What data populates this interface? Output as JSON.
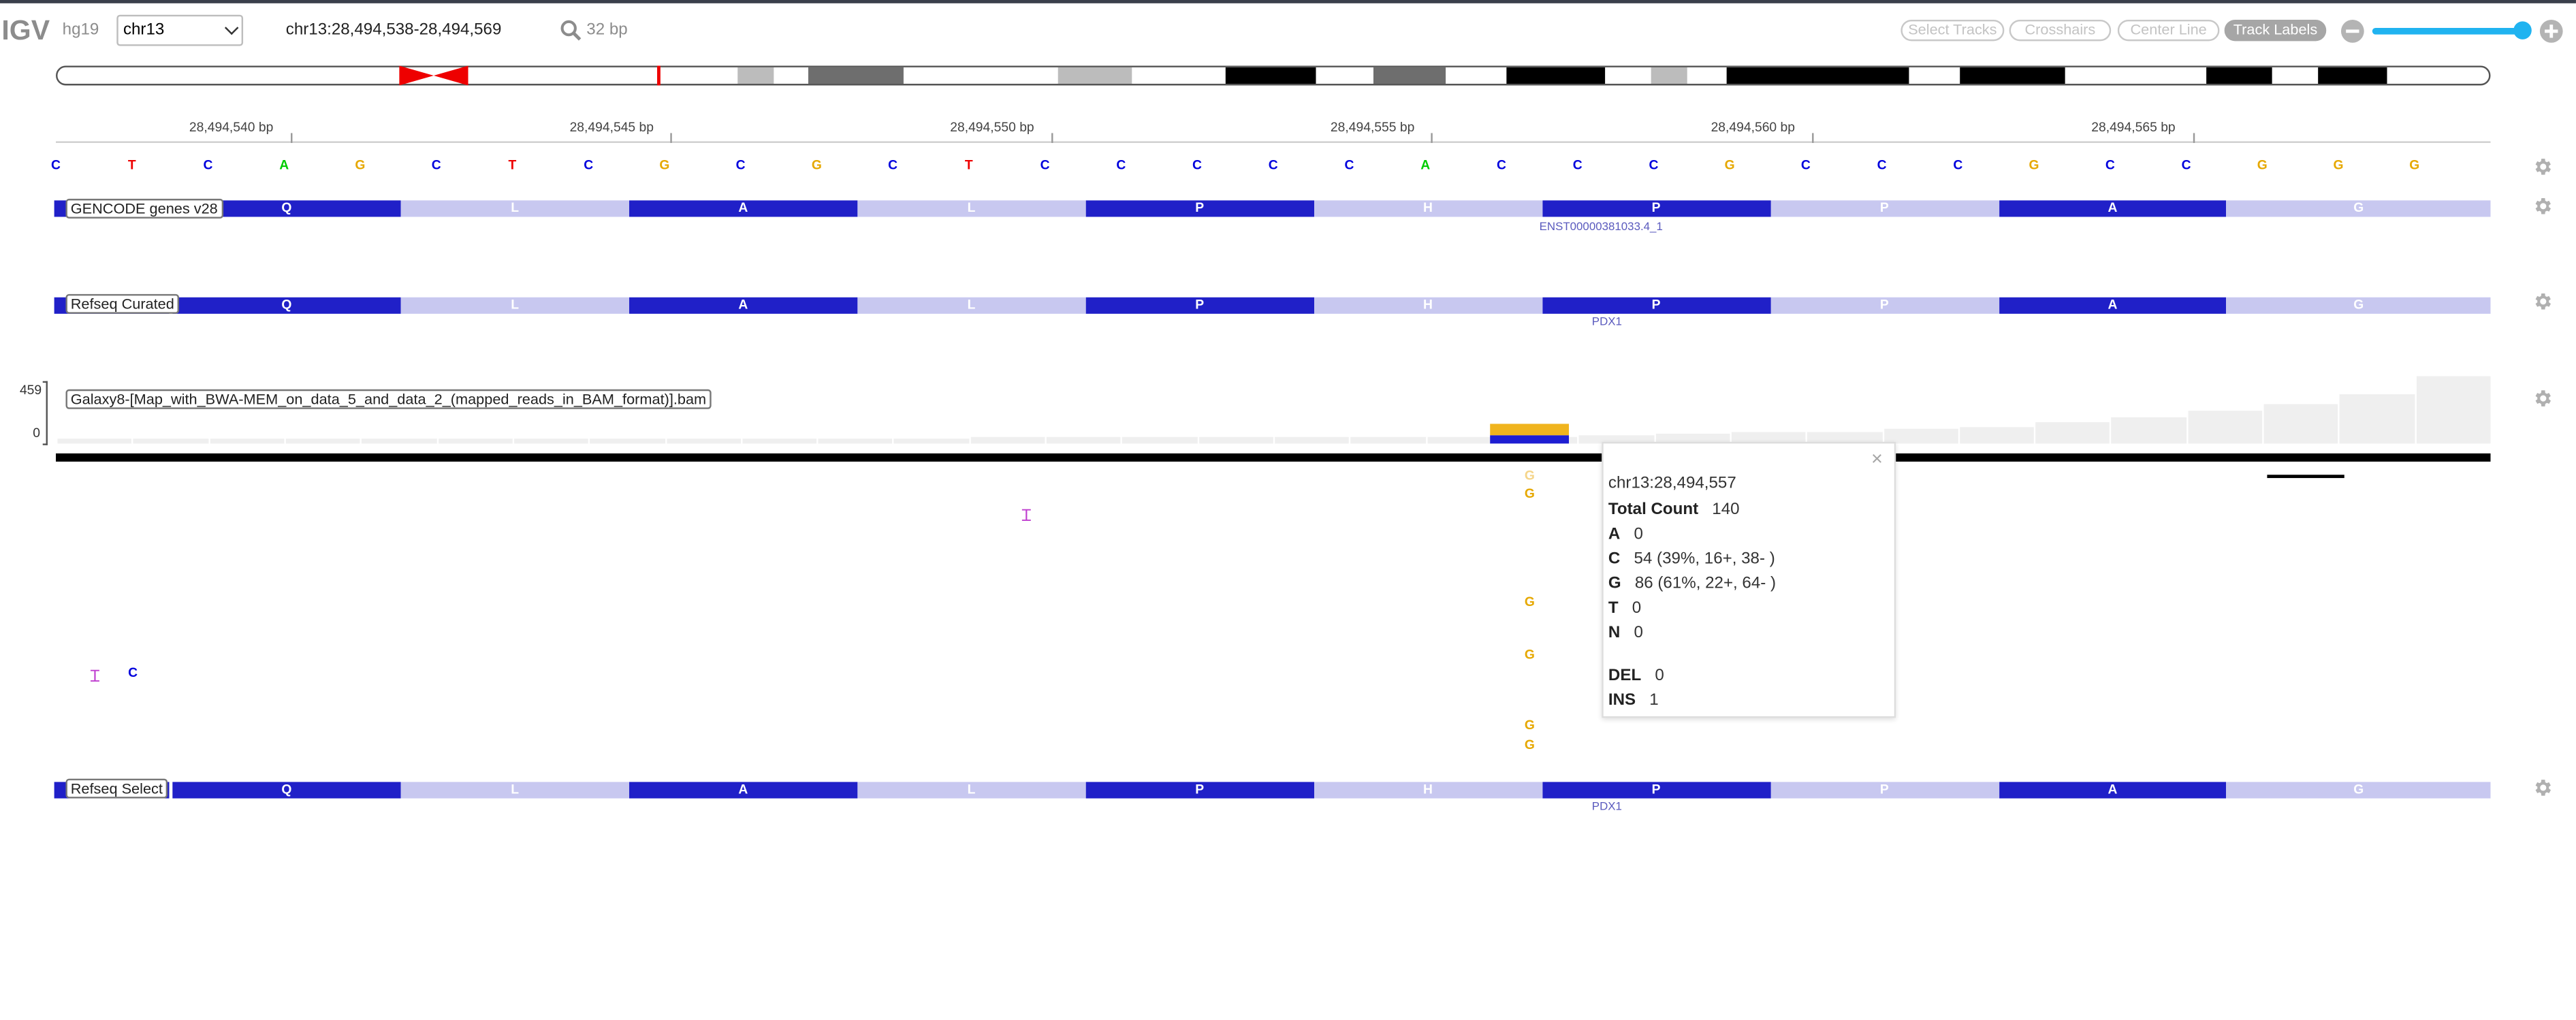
{
  "header": {
    "logo": "IGV",
    "genome": "hg19",
    "chromosome": "chr13",
    "locus": "chr13:28,494,538-28,494,569",
    "bp_width": "32 bp",
    "buttons": {
      "select_tracks": "Select Tracks",
      "crosshairs": "Crosshairs",
      "center_line": "Center Line",
      "track_labels": "Track Labels"
    },
    "zoom_level_fraction": 0.98
  },
  "ruler": {
    "ticks": [
      "28,494,540 bp",
      "28,494,545 bp",
      "28,494,550 bp",
      "28,494,555 bp",
      "28,494,560 bp",
      "28,494,565 bp"
    ]
  },
  "sequence": {
    "bases": [
      "C",
      "T",
      "C",
      "A",
      "G",
      "C",
      "T",
      "C",
      "G",
      "C",
      "G",
      "C",
      "T",
      "C",
      "C",
      "C",
      "C",
      "C",
      "A",
      "C",
      "C",
      "C",
      "G",
      "C",
      "C",
      "C",
      "G",
      "C",
      "C",
      "G",
      "G",
      "G"
    ]
  },
  "tracks": {
    "gencode": {
      "label": "GENCODE genes v28",
      "transcript": "ENST00000381033.4_1",
      "amino_acids": [
        "Q",
        "L",
        "A",
        "L",
        "P",
        "H",
        "P",
        "P",
        "A",
        "G"
      ]
    },
    "refseq_curated": {
      "label": "Refseq Curated",
      "gene": "PDX1",
      "amino_acids": [
        "Q",
        "L",
        "A",
        "L",
        "P",
        "H",
        "P",
        "P",
        "A",
        "G"
      ]
    },
    "bam": {
      "label": "Galaxy8-[Map_with_BWA-MEM_on_data_5_and_data_2_(mapped_reads_in_BAM_format)].bam",
      "scale_max": "459",
      "scale_min": "0",
      "coverage_fraction": [
        0.04,
        0.04,
        0.04,
        0.04,
        0.04,
        0.04,
        0.04,
        0.04,
        0.04,
        0.04,
        0.04,
        0.04,
        0.05,
        0.05,
        0.05,
        0.05,
        0.05,
        0.05,
        0.06,
        0.06,
        0.07,
        0.08,
        0.09,
        0.1,
        0.12,
        0.14,
        0.17,
        0.21,
        0.27,
        0.33,
        0.41,
        0.55
      ],
      "mismatch_reads": [
        "G",
        "G",
        "G",
        "G",
        "G",
        "G"
      ],
      "other_mismatch": "C"
    },
    "refseq_select": {
      "label": "Refseq Select",
      "gene": "PDX1",
      "amino_acids": [
        "Q",
        "L",
        "A",
        "L",
        "P",
        "H",
        "P",
        "P",
        "A",
        "G"
      ]
    }
  },
  "popup": {
    "position": "chr13:28,494,557",
    "total_count_label": "Total Count",
    "total_count": "140",
    "rows": [
      {
        "k": "A",
        "v": "0"
      },
      {
        "k": "C",
        "v": "54 (39%, 16+, 38- )"
      },
      {
        "k": "G",
        "v": "86 (61%, 22+, 64- )"
      },
      {
        "k": "T",
        "v": "0"
      },
      {
        "k": "N",
        "v": "0"
      }
    ],
    "del_label": "DEL",
    "del": "0",
    "ins_label": "INS",
    "ins": "1",
    "close": "×"
  },
  "colors": {
    "A": "#00cc00",
    "C": "#0000dd",
    "G": "#e6a800",
    "T": "#ee0000",
    "exon_dark": "#2020c8",
    "exon_light": "#c8c8f0",
    "accent": "#20b3f0"
  }
}
